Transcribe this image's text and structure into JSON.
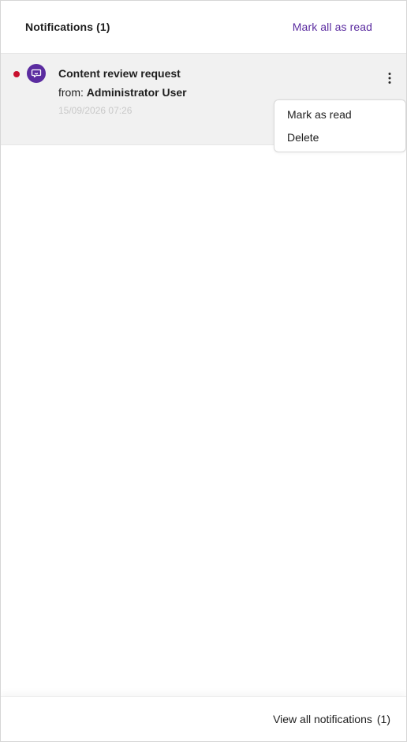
{
  "header": {
    "title": "Notifications (1)",
    "mark_all_label": "Mark all as read"
  },
  "notifications": [
    {
      "title": "Content review request",
      "from_prefix": "from:",
      "sender": "Administrator User",
      "timestamp": "15/09/2026 07:26",
      "unread": true,
      "icon": "chat-bubble-icon"
    }
  ],
  "menu": {
    "mark_read_label": "Mark as read",
    "delete_label": "Delete"
  },
  "footer": {
    "view_all_label": "View all notifications",
    "count": "(1)"
  },
  "colors": {
    "accent": "#5b2ca0",
    "unread": "#c8102e",
    "row_bg": "#f1f1f1"
  }
}
